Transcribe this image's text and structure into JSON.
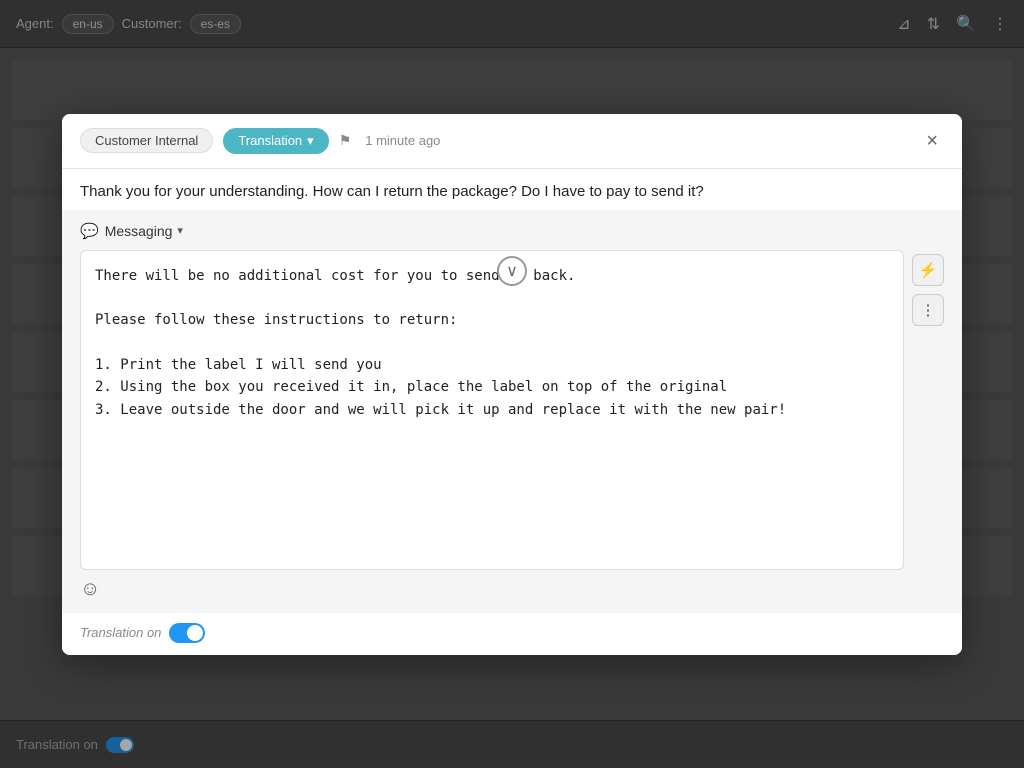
{
  "topBar": {
    "agentLabel": "Agent:",
    "agentLang": "en-us",
    "customerLabel": "Customer:",
    "customerLang": "es-es"
  },
  "modal": {
    "tabs": [
      {
        "id": "customer-internal",
        "label": "Customer Internal",
        "active": false
      },
      {
        "id": "translation",
        "label": "Translation",
        "active": true
      }
    ],
    "timestamp": "1 minute ago",
    "closeLabel": "×",
    "customerMessage": "Thank you for your understanding. How can I return the package? Do I have to pay to send it?",
    "messagingTab": "Messaging",
    "replyContent": "There will be no additional cost for you to send it back.\n\nPlease follow these instructions to return:\n\n1. Print the label I will send you\n2. Using the box you received it in, place the label on top of the original\n3. Leave outside the door and we will pick it up and replace it with the new pair!",
    "translationToggleLabel": "Translation on"
  },
  "bottomBar": {
    "label": "Translation on"
  },
  "icons": {
    "filter": "⊟",
    "sort": "↕",
    "search": "🔍",
    "more": "⋮",
    "flag": "⚑",
    "lightning": "⚡",
    "emoji": "☺",
    "chevronDown": "∨",
    "scrollDown": "∨"
  }
}
